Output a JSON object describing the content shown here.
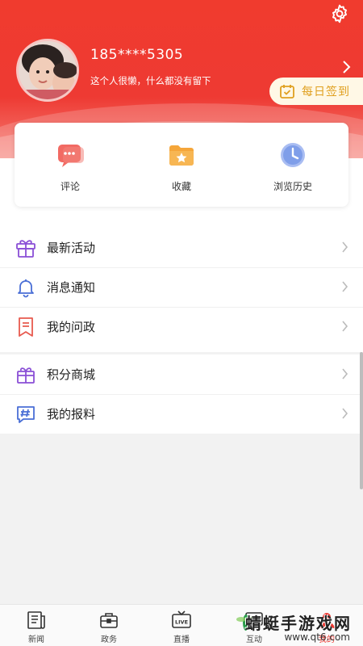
{
  "profile": {
    "phone": "185****5305",
    "bio": "这个人很懒，什么都没有留下",
    "checkin_label": "每日签到"
  },
  "quick_actions": [
    {
      "label": "评论",
      "icon": "comment-icon"
    },
    {
      "label": "收藏",
      "icon": "favorite-folder-icon"
    },
    {
      "label": "浏览历史",
      "icon": "clock-icon"
    }
  ],
  "menu_group_1": [
    {
      "label": "最新活动",
      "icon": "gift-icon"
    },
    {
      "label": "消息通知",
      "icon": "bell-icon"
    },
    {
      "label": "我的问政",
      "icon": "bookmark-icon"
    }
  ],
  "menu_group_2": [
    {
      "label": "积分商城",
      "icon": "gift-box-icon"
    },
    {
      "label": "我的报料",
      "icon": "hashtag-icon"
    }
  ],
  "tabs": [
    {
      "label": "新闻",
      "icon": "newspaper-icon"
    },
    {
      "label": "政务",
      "icon": "briefcase-icon"
    },
    {
      "label": "直播",
      "icon": "tv-live-icon"
    },
    {
      "label": "互动",
      "icon": "chat-icon"
    },
    {
      "label": "我的",
      "icon": "user-icon"
    }
  ],
  "watermark": {
    "title": "蜻蜓手游戏网",
    "url": "www.qt6.com"
  },
  "colors": {
    "brand_red": "#ee3a33",
    "checkin_gold": "#e0a020",
    "icon_purple": "#8a4fd6",
    "icon_blue": "#4a6fd6",
    "icon_red": "#e85a4f"
  }
}
